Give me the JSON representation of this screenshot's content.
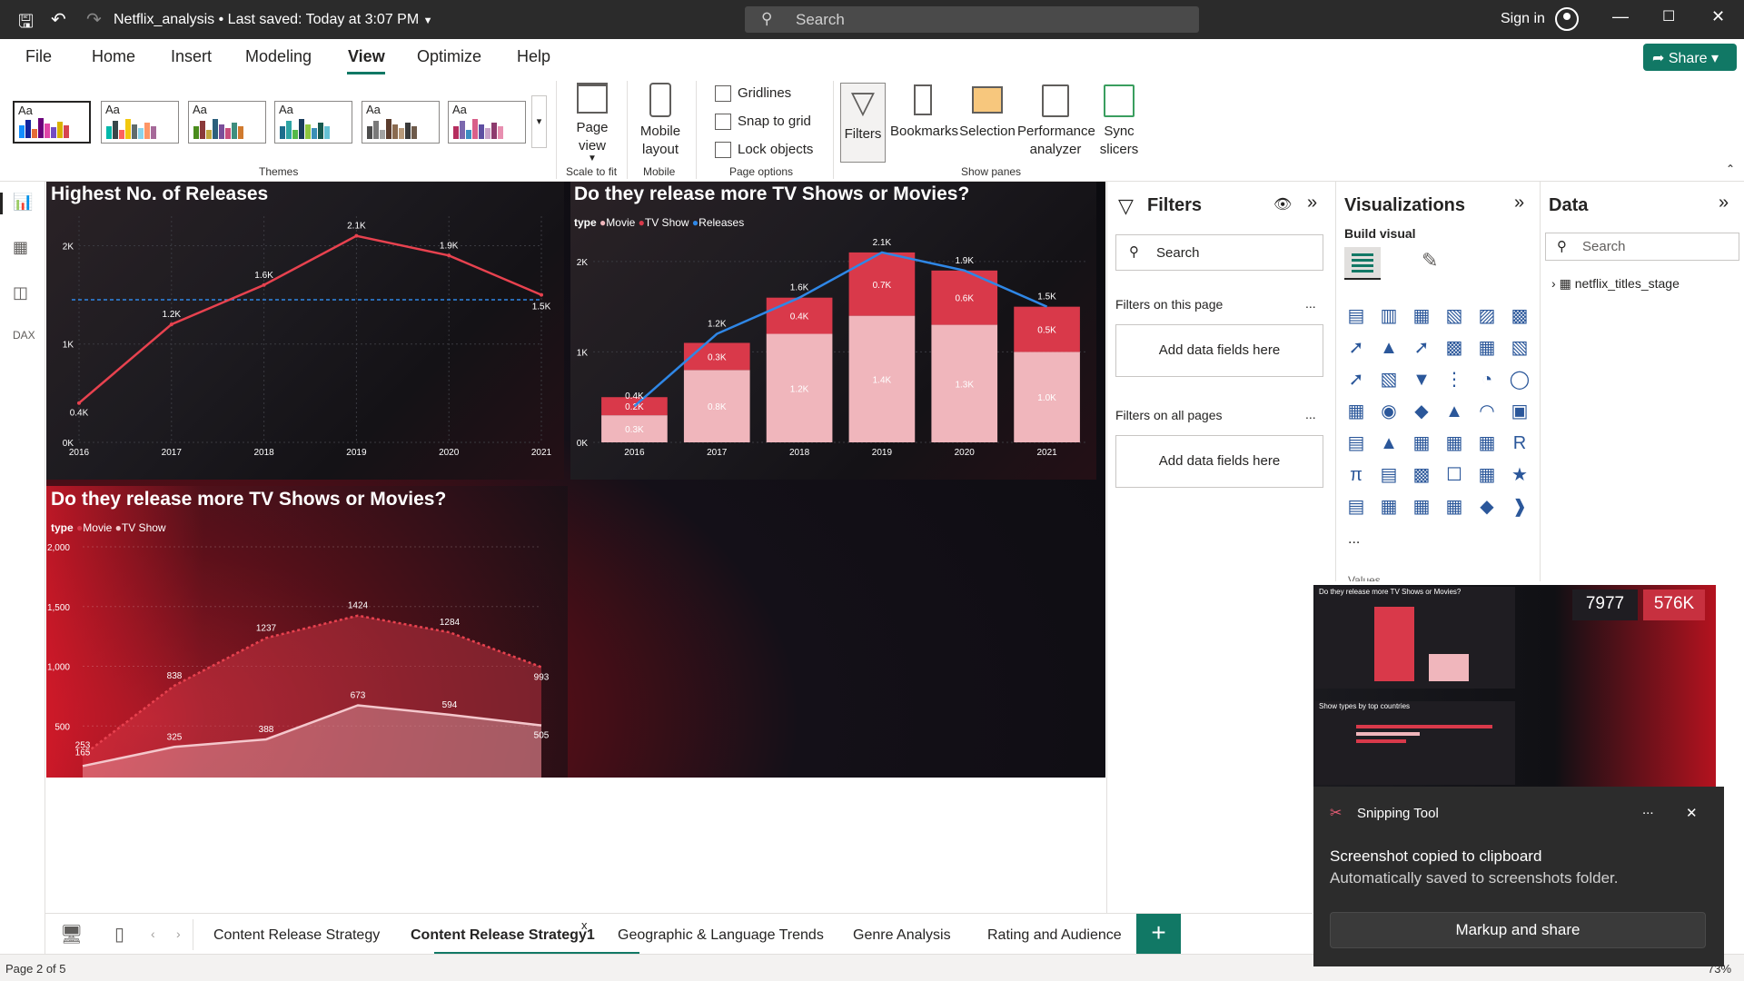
{
  "titlebar": {
    "doc_title": "Netflix_analysis",
    "separator": "•",
    "saved": "Last saved: Today at 3:07 PM",
    "search_placeholder": "Search",
    "signin": "Sign in"
  },
  "menu": {
    "items": [
      "File",
      "Home",
      "Insert",
      "Modeling",
      "View",
      "Optimize",
      "Help"
    ],
    "active": "View",
    "share": "Share"
  },
  "ribbon": {
    "theme_aa": "Aa",
    "groups": {
      "themes": "Themes",
      "scale": "Scale to fit",
      "mobile": "Mobile",
      "page_options": "Page options",
      "show_panes": "Show panes"
    },
    "page_view": "Page view",
    "mobile_layout": "Mobile layout",
    "gridlines": "Gridlines",
    "snap_to_grid": "Snap to grid",
    "lock_objects": "Lock objects",
    "filters": "Filters",
    "bookmarks": "Bookmarks",
    "selection": "Selection",
    "performance": "Performance analyzer",
    "sync": "Sync slicers"
  },
  "visual1": {
    "title": "Highest No. of Releases",
    "chart_data": {
      "type": "line",
      "x": [
        "2016",
        "2017",
        "2018",
        "2019",
        "2020",
        "2021"
      ],
      "values": [
        0.4,
        1.2,
        1.6,
        2.1,
        1.9,
        1.5
      ],
      "labels": [
        "0.4K",
        "1.2K",
        "1.6K",
        "2.1K",
        "1.9K",
        "1.5K"
      ],
      "y_ticks": [
        "0K",
        "1K",
        "2K"
      ],
      "ylim": [
        0,
        2.3
      ],
      "average_line": 1.45,
      "color": "#e8424f"
    }
  },
  "visual2": {
    "title": "Do they release more TV Shows or Movies?",
    "legend_title": "type",
    "legend": [
      "Movie",
      "TV Show",
      "Releases"
    ],
    "chart_data": {
      "type": "bar",
      "categories": [
        "2016",
        "2017",
        "2018",
        "2019",
        "2020",
        "2021"
      ],
      "series": [
        {
          "name": "Movie",
          "values": [
            0.3,
            0.8,
            1.2,
            1.4,
            1.3,
            1.0
          ],
          "labels": [
            "0.3K",
            "0.8K",
            "1.2K",
            "1.4K",
            "1.3K",
            "1.0K"
          ]
        },
        {
          "name": "TV Show",
          "values": [
            0.2,
            0.3,
            0.4,
            0.7,
            0.6,
            0.5
          ],
          "labels": [
            "0.2K",
            "0.3K",
            "0.4K",
            "0.7K",
            "0.6K",
            "0.5K"
          ]
        },
        {
          "name": "Releases",
          "values": [
            0.4,
            1.2,
            1.6,
            2.1,
            1.9,
            1.5
          ],
          "labels": [
            "0.4K",
            "1.2K",
            "1.6K",
            "2.1K",
            "1.9K",
            "1.5K"
          ]
        }
      ],
      "y_ticks": [
        "0K",
        "1K",
        "2K"
      ],
      "ylim": [
        0,
        2.3
      ],
      "colors": {
        "movie": "#f0b6bc",
        "tvshow": "#d9394a",
        "line": "#2f87e6"
      }
    }
  },
  "visual3": {
    "title": "Do they release more TV Shows or Movies?",
    "legend_title": "type",
    "legend": [
      "Movie",
      "TV Show"
    ],
    "chart_data": {
      "type": "area",
      "x": [
        "2016",
        "2017",
        "2018",
        "2019",
        "2020",
        "2021"
      ],
      "series": [
        {
          "name": "Movie",
          "values": [
            253,
            838,
            1237,
            1424,
            1284,
            993
          ]
        },
        {
          "name": "TV Show",
          "values": [
            165,
            325,
            388,
            673,
            594,
            505
          ]
        }
      ],
      "y_ticks": [
        "0",
        "500",
        "1,000",
        "1,500",
        "2,000"
      ],
      "ylim": [
        0,
        2000
      ]
    }
  },
  "filters": {
    "title": "Filters",
    "search": "Search",
    "on_page": "Filters on this page",
    "on_all": "Filters on all pages",
    "add": "Add data fields here",
    "more": "..."
  },
  "viz": {
    "title": "Visualizations",
    "build": "Build visual",
    "values_partial": "Values",
    "more": "..."
  },
  "data_pane": {
    "title": "Data",
    "search": "Search",
    "table": "netflix_titles_stage"
  },
  "tabs": [
    "Content Release Strategy",
    "Content Release Strategy1",
    "Geographic & Language Trends",
    "Genre Analysis",
    "Rating and Audience"
  ],
  "active_tab": "Content Release Strategy1",
  "tab_close": "x",
  "status": {
    "page": "Page 2 of 5",
    "zoom": "73%"
  },
  "preview": {
    "kpi1": "7977",
    "kpi2": "576K",
    "chart_title": "Do they release more TV Shows or Movies?",
    "chart2_title": "Show types by top countries"
  },
  "snip": {
    "app": "Snipping Tool",
    "heading": "Screenshot copied to clipboard",
    "body": "Automatically saved to screenshots folder.",
    "button": "Markup and share",
    "more": "...",
    "close": "✕"
  }
}
